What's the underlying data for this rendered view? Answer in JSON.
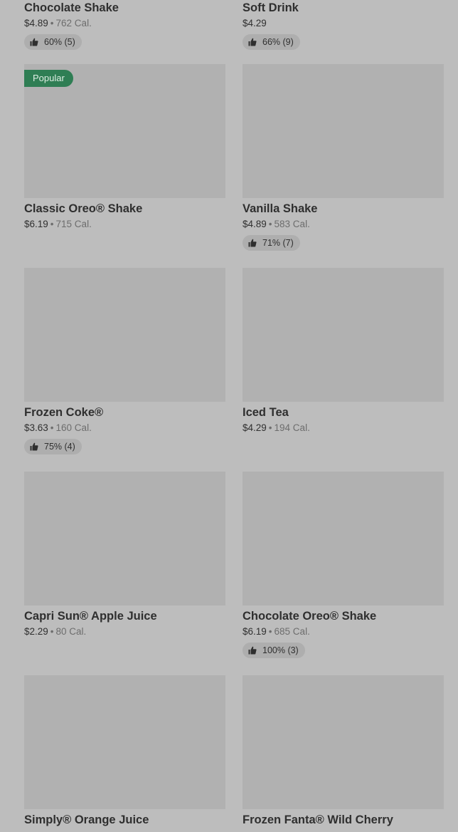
{
  "thumbs_up_icon": "thumbs-up-icon",
  "separator": "•",
  "items": [
    {
      "name": "Chocolate Shake",
      "price": "$4.89",
      "calories": "762 Cal.",
      "rating": "60% (5)"
    },
    {
      "name": "Soft Drink",
      "price": "$4.29",
      "calories": "",
      "rating": "66% (9)"
    },
    {
      "badge": "Popular",
      "name": "Classic Oreo® Shake",
      "price": "$6.19",
      "calories": "715 Cal.",
      "rating": ""
    },
    {
      "name": "Vanilla Shake",
      "price": "$4.89",
      "calories": "583 Cal.",
      "rating": "71% (7)"
    },
    {
      "name": "Frozen Coke®",
      "price": "$3.63",
      "calories": "160 Cal.",
      "rating": "75% (4)"
    },
    {
      "name": "Iced Tea",
      "price": "$4.29",
      "calories": "194 Cal.",
      "rating": ""
    },
    {
      "name": "Capri Sun® Apple Juice",
      "price": "$2.29",
      "calories": "80 Cal.",
      "rating": ""
    },
    {
      "name": "Chocolate Oreo® Shake",
      "price": "$6.19",
      "calories": "685 Cal.",
      "rating": "100% (3)"
    },
    {
      "name": "Simply® Orange Juice",
      "price": "",
      "calories": "",
      "rating": ""
    },
    {
      "name": "Frozen Fanta® Wild Cherry",
      "price": "",
      "calories": "",
      "rating": ""
    }
  ],
  "colors": {
    "background": "#bdbdbd",
    "image_placeholder": "#b1b1b1",
    "popular_badge": "#2f7e54",
    "rating_pill": "#aeaeae"
  }
}
